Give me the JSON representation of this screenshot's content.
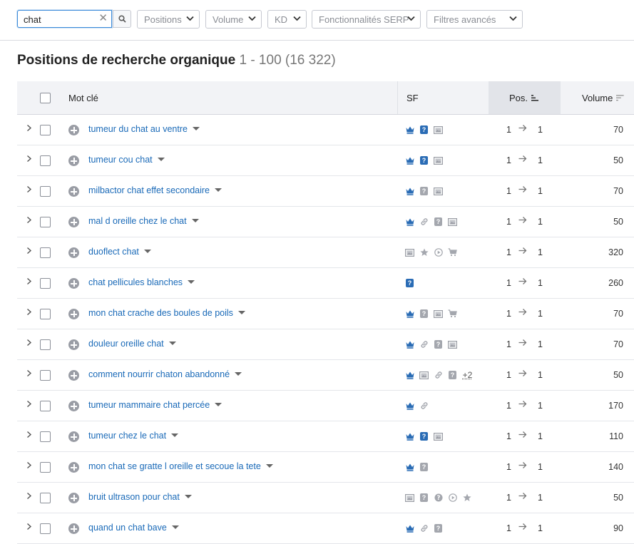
{
  "search": {
    "value": "chat"
  },
  "filters": [
    "Positions",
    "Volume",
    "KD",
    "Fonctionnalités SERP",
    "Filtres avancés"
  ],
  "title": {
    "main": "Positions de recherche organique",
    "range": "1 - 100 (16 322)"
  },
  "table": {
    "headers": {
      "keyword": "Mot clé",
      "sf": "SF",
      "pos": "Pos.",
      "volume": "Volume"
    },
    "rows": [
      {
        "keyword": "tumeur du chat au ventre",
        "sf": [
          "crown-icon",
          "paid-question-icon",
          "image-icon"
        ],
        "more": "",
        "pos_from": "1",
        "pos_to": "1",
        "volume": "70"
      },
      {
        "keyword": "tumeur cou chat",
        "sf": [
          "crown-icon",
          "paid-question-icon",
          "image-icon"
        ],
        "more": "",
        "pos_from": "1",
        "pos_to": "1",
        "volume": "50"
      },
      {
        "keyword": "milbactor chat effet secondaire",
        "sf": [
          "crown-icon",
          "question-icon",
          "image-icon"
        ],
        "more": "",
        "pos_from": "1",
        "pos_to": "1",
        "volume": "70"
      },
      {
        "keyword": "mal d oreille chez le chat",
        "sf": [
          "crown-icon",
          "link-icon",
          "question-icon",
          "image-icon"
        ],
        "more": "",
        "pos_from": "1",
        "pos_to": "1",
        "volume": "50"
      },
      {
        "keyword": "duoflect chat",
        "sf": [
          "image-icon",
          "star-icon",
          "video-icon",
          "cart-icon"
        ],
        "more": "",
        "pos_from": "1",
        "pos_to": "1",
        "volume": "320"
      },
      {
        "keyword": "chat pellicules blanches",
        "sf": [
          "paid-question-icon"
        ],
        "more": "",
        "pos_from": "1",
        "pos_to": "1",
        "volume": "260"
      },
      {
        "keyword": "mon chat crache des boules de poils",
        "sf": [
          "crown-icon",
          "question-icon",
          "image-icon",
          "cart-icon"
        ],
        "more": "",
        "pos_from": "1",
        "pos_to": "1",
        "volume": "70"
      },
      {
        "keyword": "douleur oreille chat",
        "sf": [
          "crown-icon",
          "link-icon",
          "question-icon",
          "image-icon"
        ],
        "more": "",
        "pos_from": "1",
        "pos_to": "1",
        "volume": "70"
      },
      {
        "keyword": "comment nourrir chaton abandonné",
        "sf": [
          "crown-icon",
          "image-icon",
          "link-icon",
          "question-icon"
        ],
        "more": "+2",
        "pos_from": "1",
        "pos_to": "1",
        "volume": "50"
      },
      {
        "keyword": "tumeur mammaire chat percée",
        "sf": [
          "crown-icon",
          "link-icon"
        ],
        "more": "",
        "pos_from": "1",
        "pos_to": "1",
        "volume": "170"
      },
      {
        "keyword": "tumeur chez le chat",
        "sf": [
          "crown-icon",
          "paid-question-icon",
          "image-icon"
        ],
        "more": "",
        "pos_from": "1",
        "pos_to": "1",
        "volume": "110"
      },
      {
        "keyword": "mon chat se gratte l oreille et secoue la tete",
        "sf": [
          "crown-icon",
          "question-icon"
        ],
        "more": "",
        "pos_from": "1",
        "pos_to": "1",
        "volume": "140"
      },
      {
        "keyword": "bruit ultrason pour chat",
        "sf": [
          "image-icon",
          "question-icon",
          "help-circle-icon",
          "video-icon",
          "star-icon"
        ],
        "more": "",
        "pos_from": "1",
        "pos_to": "1",
        "volume": "50"
      },
      {
        "keyword": "quand un chat bave",
        "sf": [
          "crown-icon",
          "link-icon",
          "question-icon"
        ],
        "more": "",
        "pos_from": "1",
        "pos_to": "1",
        "volume": "90"
      }
    ]
  },
  "colors": {
    "link": "#1a6ab8",
    "accent": "#2a6cb5",
    "header_bg": "#f2f3f6",
    "sorted_header_bg": "#e2e4e9",
    "focus": "#3b8ad9"
  }
}
